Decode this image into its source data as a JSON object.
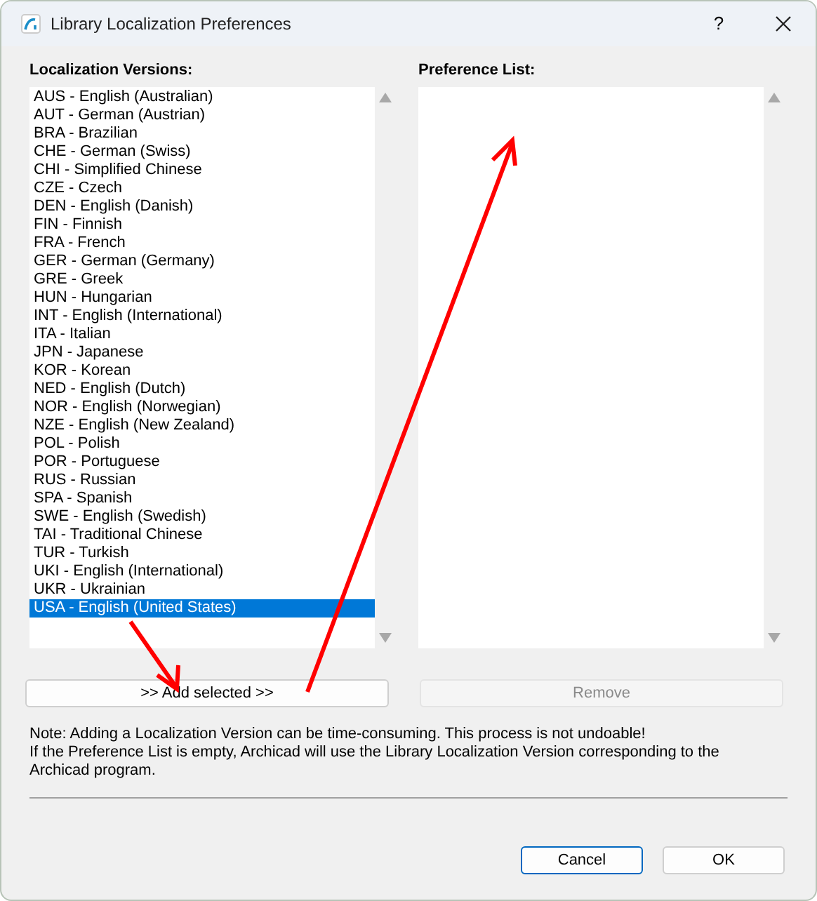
{
  "window": {
    "title": "Library Localization Preferences",
    "help": "?"
  },
  "versions": {
    "label": "Localization Versions:",
    "items": [
      {
        "text": "AUS - English (Australian)",
        "selected": false
      },
      {
        "text": "AUT - German (Austrian)",
        "selected": false
      },
      {
        "text": "BRA - Brazilian",
        "selected": false
      },
      {
        "text": "CHE - German (Swiss)",
        "selected": false
      },
      {
        "text": "CHI - Simplified Chinese",
        "selected": false
      },
      {
        "text": "CZE - Czech",
        "selected": false
      },
      {
        "text": "DEN - English (Danish)",
        "selected": false
      },
      {
        "text": "FIN - Finnish",
        "selected": false
      },
      {
        "text": "FRA - French",
        "selected": false
      },
      {
        "text": "GER - German (Germany)",
        "selected": false
      },
      {
        "text": "GRE - Greek",
        "selected": false
      },
      {
        "text": "HUN - Hungarian",
        "selected": false
      },
      {
        "text": "INT - English (International)",
        "selected": false
      },
      {
        "text": "ITA - Italian",
        "selected": false
      },
      {
        "text": "JPN - Japanese",
        "selected": false
      },
      {
        "text": "KOR - Korean",
        "selected": false
      },
      {
        "text": "NED - English (Dutch)",
        "selected": false
      },
      {
        "text": "NOR - English (Norwegian)",
        "selected": false
      },
      {
        "text": "NZE - English (New Zealand)",
        "selected": false
      },
      {
        "text": "POL - Polish",
        "selected": false
      },
      {
        "text": "POR - Portuguese",
        "selected": false
      },
      {
        "text": "RUS - Russian",
        "selected": false
      },
      {
        "text": "SPA - Spanish",
        "selected": false
      },
      {
        "text": "SWE - English (Swedish)",
        "selected": false
      },
      {
        "text": "TAI - Traditional Chinese",
        "selected": false
      },
      {
        "text": "TUR - Turkish",
        "selected": false
      },
      {
        "text": "UKI - English (International)",
        "selected": false
      },
      {
        "text": "UKR - Ukrainian",
        "selected": false
      },
      {
        "text": "USA - English (United States)",
        "selected": true
      }
    ]
  },
  "preferences": {
    "label": "Preference List:"
  },
  "add_button": {
    "label": ">> Add selected >>",
    "disabled": false
  },
  "remove_button": {
    "label": "Remove",
    "disabled": true
  },
  "note": [
    "Note: Adding a Localization Version can be time-consuming. This process is not undoable!",
    "If the Preference List is empty, Archicad will use the Library Localization Version corresponding to the Archicad program."
  ],
  "buttons": [
    {
      "label": "Cancel",
      "default": true
    },
    {
      "label": "OK",
      "default": false
    }
  ]
}
